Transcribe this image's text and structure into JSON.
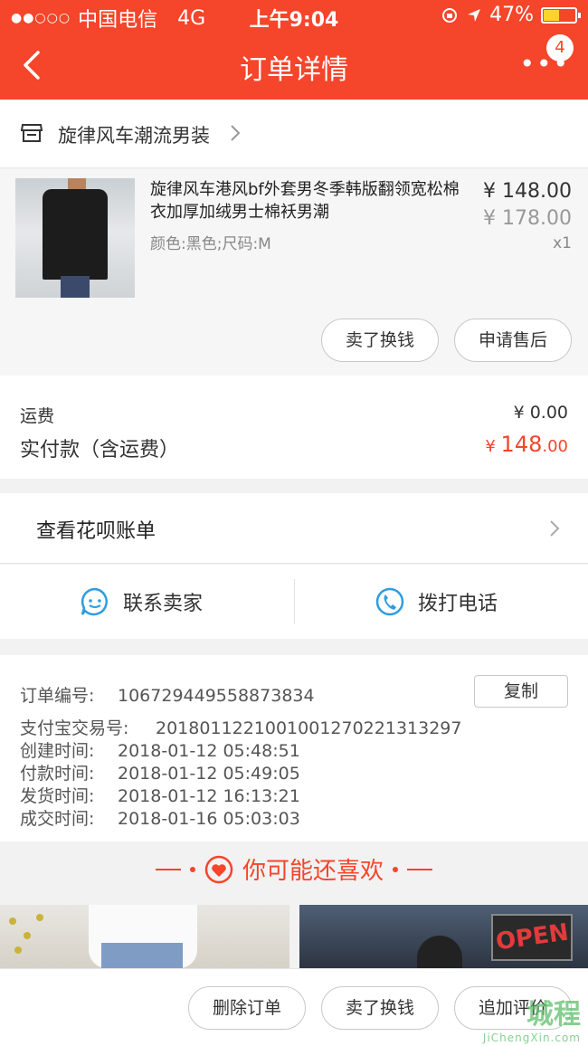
{
  "status_bar": {
    "carrier": "中国电信",
    "network": "4G",
    "time": "上午9:04",
    "battery": "47%",
    "battery_level": 0.47,
    "signal_icon": "signal-dots-icon",
    "lock_icon": "rotation-lock-icon",
    "location_icon": "location-arrow-icon"
  },
  "nav": {
    "title": "订单详情",
    "badge": "4",
    "back_icon": "back-chevron-icon",
    "more_icon": "more-dots-icon"
  },
  "shop": {
    "name": "旋律风车潮流男装",
    "icon": "store-icon"
  },
  "product": {
    "title": "旋律风车港风bf外套男冬季韩版翻领宽松棉衣加厚加绒男士棉袄男潮",
    "spec": "颜色:黑色;尺码:M",
    "price": "¥ 148.00",
    "original_price": "¥ 178.00",
    "quantity": "x1",
    "actions": [
      "卖了换钱",
      "申请售后"
    ]
  },
  "fees": {
    "shipping_label": "运费",
    "shipping_value": "¥ 0.00",
    "paid_label": "实付款（含运费）",
    "paid_symbol": "¥ ",
    "paid_int": "148",
    "paid_dec": ".00"
  },
  "huabei": {
    "label": "查看花呗账单"
  },
  "contact": {
    "seller_label": "联系卖家",
    "phone_label": "拨打电话",
    "seller_icon": "chat-bubble-icon",
    "phone_icon": "phone-icon"
  },
  "order_info": {
    "copy_label": "复制",
    "rows": [
      {
        "k": "订单编号:",
        "v": "106729449558873834"
      },
      {
        "k": "支付宝交易号:",
        "v": "2018011221001001270221313297"
      },
      {
        "k": "创建时间:",
        "v": "2018-01-12 05:48:51"
      },
      {
        "k": "付款时间:",
        "v": "2018-01-12 05:49:05"
      },
      {
        "k": "发货时间:",
        "v": "2018-01-12 16:13:21"
      },
      {
        "k": "成交时间:",
        "v": "2018-01-16 05:03:03"
      }
    ]
  },
  "guess": {
    "title": "你可能还喜欢",
    "icon": "heart-icon"
  },
  "recommendations": {
    "sign_text": "OPEN"
  },
  "bottom_actions": [
    "删除订单",
    "卖了换钱",
    "追加评价"
  ],
  "watermark": {
    "text": "城程",
    "sub": "JiChengXin.com"
  },
  "colors": {
    "brand": "#f5452a",
    "accent_blue": "#2e9de0"
  }
}
